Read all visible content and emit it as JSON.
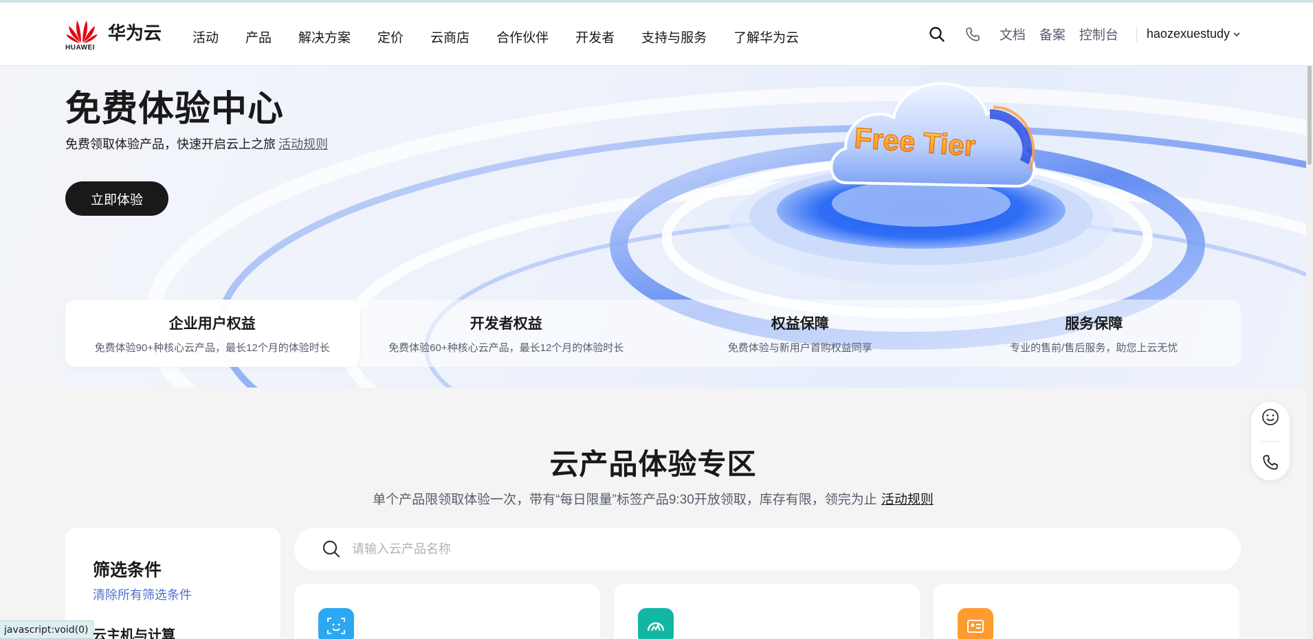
{
  "brand": {
    "cn": "华为云",
    "en": "HUAWEI",
    "logo_color": "#e60012"
  },
  "nav": {
    "items": [
      "活动",
      "产品",
      "解决方案",
      "定价",
      "云商店",
      "合作伙伴",
      "开发者",
      "支持与服务",
      "了解华为云"
    ],
    "right_links": [
      "文档",
      "备案",
      "控制台"
    ],
    "user": "haozexuestudy",
    "icons": [
      "search-icon",
      "phone-icon",
      "chevron-down-icon"
    ]
  },
  "hero": {
    "title": "免费体验中心",
    "subtitle": "免费领取体验产品，快速开启云上之旅",
    "rules_link": "活动规则",
    "cta": "立即体验",
    "badge_text": "Free Tier"
  },
  "benefits": [
    {
      "title": "企业用户权益",
      "desc": "免费体验90+种核心云产品，最长12个月的体验时长",
      "active": true
    },
    {
      "title": "开发者权益",
      "desc": "免费体验60+种核心云产品，最长12个月的体验时长",
      "active": false
    },
    {
      "title": "权益保障",
      "desc": "免费体验与新用户首购权益同享",
      "active": false
    },
    {
      "title": "服务保障",
      "desc": "专业的售前/售后服务，助您上云无忧",
      "active": false
    }
  ],
  "section": {
    "title": "云产品体验专区",
    "subtitle": "单个产品限领取体验一次，带有“每日限量”标签产品9:30开放领取，库存有限，领完为止",
    "rules_link": "活动规则"
  },
  "filter": {
    "title": "筛选条件",
    "clear": "清除所有筛选条件",
    "next_heading": "云主机与计算"
  },
  "search": {
    "placeholder": "请输入云产品名称",
    "value": ""
  },
  "cards": [
    {
      "icon": "face-scan-icon",
      "color": "#2aa8f2"
    },
    {
      "icon": "monitor-gauge-icon",
      "color": "#12b7a3"
    },
    {
      "icon": "id-card-icon",
      "color": "#ff9a2e"
    }
  ],
  "float": {
    "icons": [
      "smile-icon",
      "phone-icon"
    ]
  },
  "status_bar": "javascript:void(0)"
}
